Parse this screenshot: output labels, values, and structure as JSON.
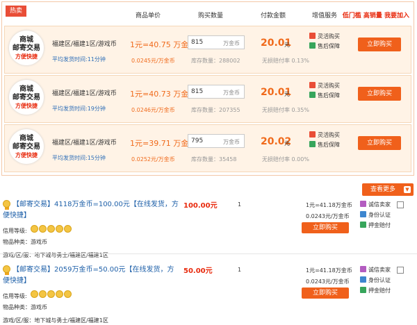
{
  "header": {
    "hot_tag": "热卖",
    "col_unit_price": "商品单价",
    "col_quantity": "购买数量",
    "col_payment": "付款金额",
    "col_service": "增值服务",
    "promo": "低门槛 高销量 我要加入"
  },
  "colors": {
    "accent": "#f0601b",
    "price": "#f06a1b",
    "link": "#1d5fa8"
  },
  "offers": [
    {
      "logo": [
        "商城",
        "邮寄交易",
        "方便快捷"
      ],
      "region": "福建区/福建1区/游戏币",
      "avg_time": "平均发货时间:11分钟",
      "price": "1元=40.75 万金币",
      "unit_price": "0.0245元/万金币",
      "quantity": "815",
      "quantity_unit": "万金币",
      "stock": "库存数量：288002",
      "pay": "20.01",
      "pay_unit": "元",
      "compensation": "无损赔付率 0.13%",
      "service1": "灵活购买",
      "service2": "售后保障",
      "buy": "立即购买"
    },
    {
      "logo": [
        "商城",
        "邮寄交易",
        "方便快捷"
      ],
      "region": "福建区/福建1区/游戏币",
      "avg_time": "平均发货时间:19分钟",
      "price": "1元=40.73 万金币",
      "unit_price": "0.0246元/万金币",
      "quantity": "815",
      "quantity_unit": "万金币",
      "stock": "库存数量：207355",
      "pay": "20.01",
      "pay_unit": "元",
      "compensation": "无损赔付率 0.35%",
      "service1": "灵活购买",
      "service2": "售后保障",
      "buy": "立即购买"
    },
    {
      "logo": [
        "商城",
        "邮寄交易",
        "方便快捷"
      ],
      "region": "福建区/福建1区/游戏币",
      "avg_time": "平均发货时间:15分钟",
      "price": "1元=39.71 万金币",
      "unit_price": "0.0252元/万金币",
      "quantity": "795",
      "quantity_unit": "万金币",
      "stock": "库存数量：35458",
      "pay": "20.02",
      "pay_unit": "元",
      "compensation": "无损赔付率 0.00%",
      "service1": "灵活购买",
      "service2": "售后保障",
      "buy": "立即购买"
    }
  ],
  "more_label": "查看更多",
  "listings": [
    {
      "title": "【邮寄交易】4118万金币=100.00元【在线发货，方便快捷】",
      "credit_label": "信用等级:",
      "kind": "物品种类：游戏币",
      "server": "游戏/区/服：地下城与勇士/福建区/福建1区",
      "price": "100.00元",
      "qty": "1",
      "ratio1": "1元=41.18万金币",
      "ratio2": "0.0243元/万金币",
      "buy": "立即购买",
      "svc": [
        "诚信卖家",
        "身份认证",
        "押金赔付"
      ]
    },
    {
      "title": "【邮寄交易】2059万金币=50.00元【在线发货，方便快捷】",
      "credit_label": "信用等级:",
      "kind": "物品种类：游戏币",
      "server": "游戏/区/服：地下城与勇士/福建区/福建1区",
      "price": "50.00元",
      "qty": "1",
      "ratio1": "1元=41.18万金币",
      "ratio2": "0.0243元/万金币",
      "buy": "立即购买",
      "svc": [
        "诚信卖家",
        "身份认证",
        "押金赔付"
      ]
    }
  ]
}
